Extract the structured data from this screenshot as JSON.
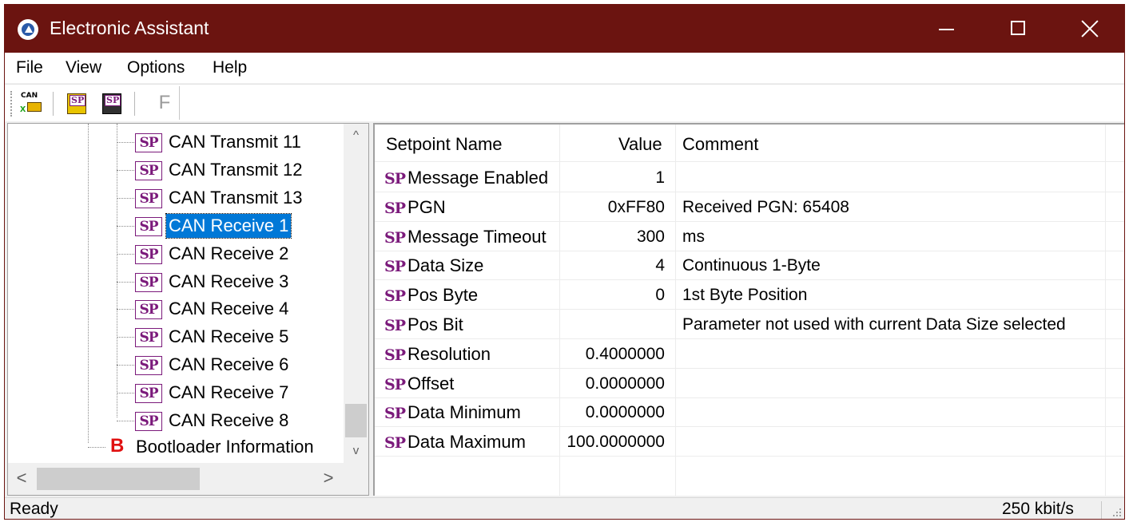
{
  "window": {
    "title": "Electronic Assistant"
  },
  "menu": [
    "File",
    "View",
    "Options",
    "Help"
  ],
  "toolbar": {
    "can_label": "CAN",
    "sp_label": "SP",
    "f_label": "F"
  },
  "tree": {
    "badge": "SP",
    "items": [
      {
        "label": "CAN Transmit 11",
        "selected": false
      },
      {
        "label": "CAN Transmit 12",
        "selected": false
      },
      {
        "label": "CAN Transmit 13",
        "selected": false
      },
      {
        "label": "CAN Receive 1",
        "selected": true
      },
      {
        "label": "CAN Receive 2",
        "selected": false
      },
      {
        "label": "CAN Receive 3",
        "selected": false
      },
      {
        "label": "CAN Receive 4",
        "selected": false
      },
      {
        "label": "CAN Receive 5",
        "selected": false
      },
      {
        "label": "CAN Receive 6",
        "selected": false
      },
      {
        "label": "CAN Receive 7",
        "selected": false
      },
      {
        "label": "CAN Receive 8",
        "selected": false
      }
    ],
    "bootloader": {
      "badge": "B",
      "label": "Bootloader Information"
    }
  },
  "list": {
    "columns": {
      "name": "Setpoint Name",
      "value": "Value",
      "comment": "Comment"
    },
    "badge": "SP",
    "rows": [
      {
        "name": "Message Enabled",
        "value": "1",
        "comment": ""
      },
      {
        "name": "PGN",
        "value": "0xFF80",
        "comment": "Received PGN: 65408"
      },
      {
        "name": "Message Timeout",
        "value": "300",
        "comment": "ms"
      },
      {
        "name": "Data Size",
        "value": "4",
        "comment": "Continuous 1-Byte"
      },
      {
        "name": "Pos Byte",
        "value": "0",
        "comment": "1st Byte Position"
      },
      {
        "name": "Pos Bit",
        "value": "",
        "comment": "Parameter not used with current Data Size selected"
      },
      {
        "name": "Resolution",
        "value": "0.4000000",
        "comment": ""
      },
      {
        "name": "Offset",
        "value": "0.0000000",
        "comment": ""
      },
      {
        "name": "Data Minimum",
        "value": "0.0000000",
        "comment": ""
      },
      {
        "name": "Data Maximum",
        "value": "100.0000000",
        "comment": ""
      }
    ]
  },
  "scrollbar_glyphs": {
    "up": "^",
    "down": "v",
    "left": "<",
    "right": ">"
  },
  "status": {
    "left": "Ready",
    "right": "250 kbit/s"
  },
  "colors": {
    "titlebar": "#6b1410",
    "selection": "#0078d7",
    "sp_badge": "#7b1a7b",
    "bootloader_badge": "#e01010"
  }
}
